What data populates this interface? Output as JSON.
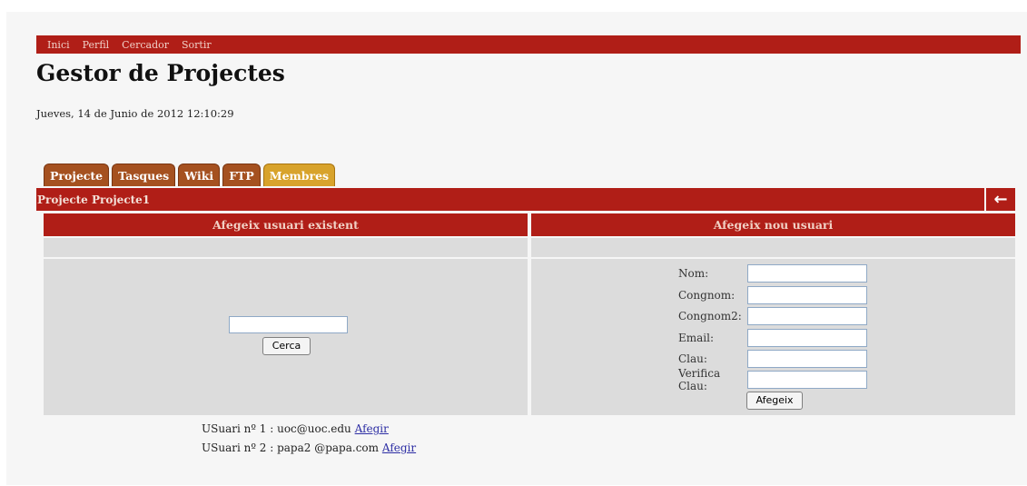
{
  "nav": {
    "items": [
      "Inici",
      "Perfil",
      "Cercador",
      "Sortir"
    ]
  },
  "header": {
    "title": "Gestor de Projectes",
    "date": "Jueves, 14 de Junio de 2012 12:10:29"
  },
  "tabs": [
    {
      "label": "Projecte",
      "active": false
    },
    {
      "label": "Tasques",
      "active": false
    },
    {
      "label": "Wiki",
      "active": false
    },
    {
      "label": "FTP",
      "active": false
    },
    {
      "label": "Membres",
      "active": true
    }
  ],
  "project_bar": {
    "label": "Projecte Projecte1",
    "back_icon": "arrow-left-icon"
  },
  "left_panel": {
    "header": "Afegeix usuari existent",
    "search_value": "",
    "search_button": "Cerca"
  },
  "right_panel": {
    "header": "Afegeix nou usuari",
    "fields": [
      {
        "label": "Nom:",
        "value": ""
      },
      {
        "label": "Congnom:",
        "value": ""
      },
      {
        "label": "Congnom2:",
        "value": ""
      },
      {
        "label": "Email:",
        "value": ""
      },
      {
        "label": "Clau:",
        "value": ""
      },
      {
        "label": "Verifica Clau:",
        "value": ""
      }
    ],
    "submit_button": "Afegeix"
  },
  "users": [
    {
      "text": "USuari nº 1 : uoc@uoc.edu",
      "link": "Afegir"
    },
    {
      "text": "USuari nº 2 : papa2 @papa.com",
      "link": "Afegir"
    }
  ],
  "colors": {
    "primary_red": "#b01e17",
    "tab_brown": "#a55120",
    "tab_active": "#d8a32c",
    "panel_gray": "#dcdcdc"
  }
}
